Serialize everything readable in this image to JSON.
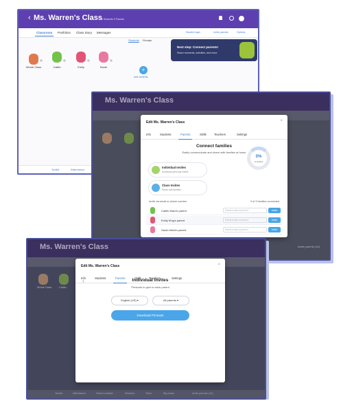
{
  "colors": {
    "brand": "#5d3fb0",
    "accent": "#4aa6e8",
    "link": "#3f7fd0",
    "frame": "#5b60b8"
  },
  "screen1": {
    "back_icon": "chevron-left-icon",
    "title": "Ms. Warren's Class",
    "meta": "4 Students  0 Parents",
    "nav": [
      "Classroom",
      "Portfolios",
      "Class Story",
      "Messages"
    ],
    "nav_right": [
      "Student login",
      "Invite parents",
      "Options"
    ],
    "popover_title": "Next step: Connect parents!",
    "popover_desc": "Share moments, activities, and more",
    "view_tabs": [
      "Students",
      "Groups"
    ],
    "students": [
      {
        "name": "Whole Class"
      },
      {
        "name": "Caitlin"
      },
      {
        "name": "Emily"
      },
      {
        "name": "Sarah"
      }
    ],
    "add_label": "Add students",
    "footer": [
      "Toolkit",
      "Attendance"
    ]
  },
  "screen2": {
    "title": "Ms. Warren's Class",
    "modal_title": "Edit Ms. Warren's Class",
    "tabs": [
      "Info",
      "Students",
      "Parents",
      "Skills",
      "Teachers",
      "Settings"
    ],
    "active_tab": "Parents",
    "heading": "Connect families",
    "subheading": "Easily communicate and share with families at home",
    "cards": [
      {
        "title": "Individual Invites",
        "desc": "Download personal invites"
      },
      {
        "title": "Class Invites",
        "desc": "Share with families"
      }
    ],
    "percent": "0%",
    "percent_label": "of families",
    "invite_label": "Invite via email or phone number",
    "connected": "0 of 3 families connected",
    "parents": [
      {
        "name": "Caitlin Ward's parent",
        "placeholder": "Parent email or phone #",
        "button": "Invite"
      },
      {
        "name": "Emily King's parent",
        "placeholder": "Parent email or phone #",
        "button": "Invite"
      },
      {
        "name": "Sarah Ward's parent",
        "placeholder": "Parent email or phone #",
        "button": "Invite"
      }
    ],
    "side_label": "Invite parents (14)"
  },
  "screen3": {
    "title": "Ms. Warren's Class",
    "modal_title": "Edit Ms. Warren's Class",
    "tabs": [
      "Info",
      "Students",
      "Parents",
      "Skills",
      "Teachers",
      "Settings"
    ],
    "heading": "Individual Invites",
    "subheading": "Printouts to give to each parent",
    "language": "English (US)",
    "audience": "All parents",
    "button": "Download Printouts",
    "students": [
      "Whole Class",
      "Caitlin"
    ],
    "footer": [
      "Toolkit",
      "Attendance",
      "Select multiple",
      "Random",
      "Timer",
      "Big Ideas",
      "Invite parents (14)"
    ]
  }
}
